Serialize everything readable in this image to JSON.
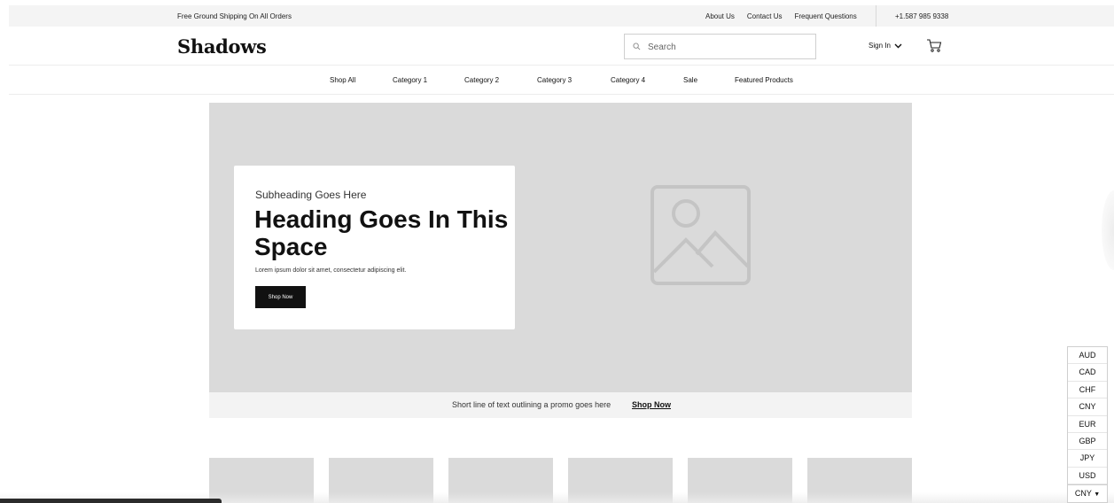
{
  "topbar": {
    "shipping": "Free Ground Shipping On All Orders",
    "links": [
      "About Us",
      "Contact Us",
      "Frequent Questions"
    ],
    "phone": "+1.587 985 9338"
  },
  "header": {
    "logo": "Shadows",
    "search_placeholder": "Search",
    "sign_in": "Sign In",
    "icons": {
      "search": "search-icon",
      "cart": "cart-icon",
      "chevron": "chevron-down-icon"
    }
  },
  "nav": {
    "items": [
      "Shop All",
      "Category 1",
      "Category 2",
      "Category 3",
      "Category 4",
      "Sale",
      "Featured Products"
    ]
  },
  "hero": {
    "subheading": "Subheading Goes Here",
    "heading": "Heading Goes In This Space",
    "body": "Lorem ipsum dolor sit amet, consectetur adipiscing elit.",
    "button": "Shop Now",
    "image_icon": "image-placeholder-icon"
  },
  "promo": {
    "text": "Short line of text outlining a promo goes here",
    "link": "Shop Now"
  },
  "currency": {
    "options": [
      "AUD",
      "CAD",
      "CHF",
      "CNY",
      "EUR",
      "GBP",
      "JPY",
      "USD"
    ],
    "selected": "CNY"
  },
  "colors": {
    "placeholder_gray": "#dadada",
    "button_black": "#111111",
    "topbar_bg": "#f4f4f4"
  }
}
